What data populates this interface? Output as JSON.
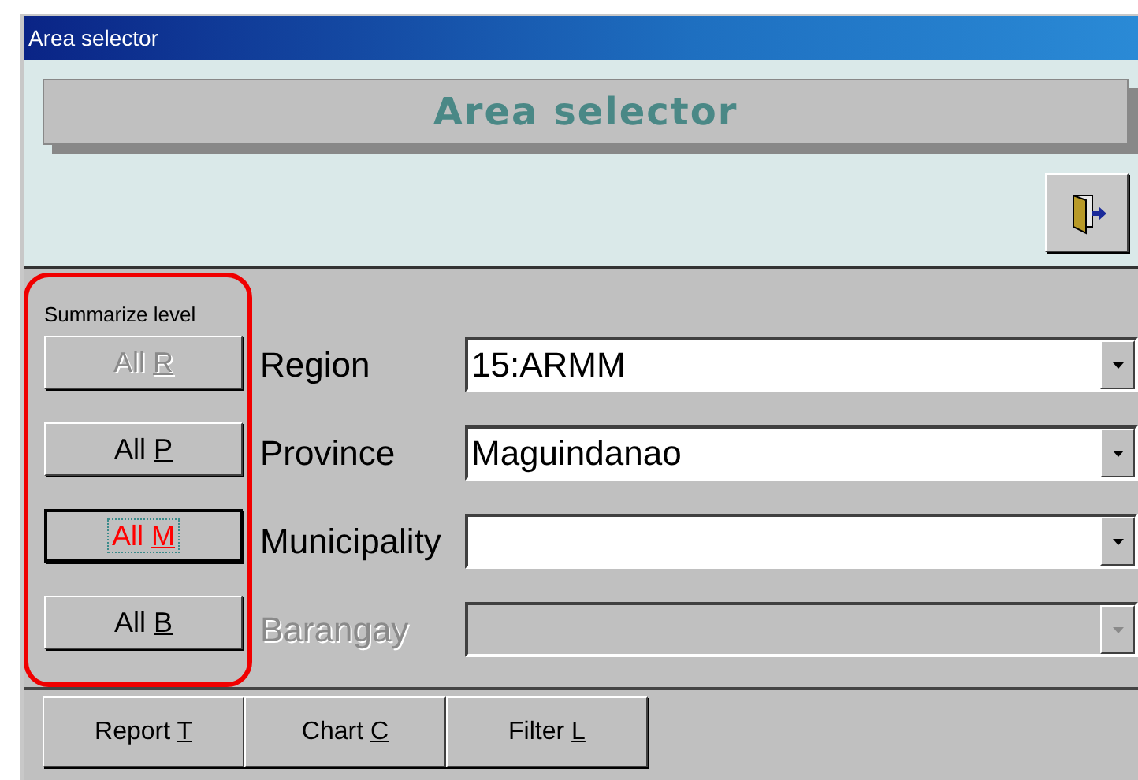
{
  "window": {
    "title": "Area selector"
  },
  "banner": {
    "title": "Area selector"
  },
  "summarize": {
    "label": "Summarize level",
    "highlighted": true,
    "buttons": [
      {
        "label": "All",
        "key": "R",
        "disabled": true,
        "focused": false
      },
      {
        "label": "All",
        "key": "P",
        "disabled": false,
        "focused": false
      },
      {
        "label": "All",
        "key": "M",
        "disabled": false,
        "focused": true
      },
      {
        "label": "All",
        "key": "B",
        "disabled": false,
        "focused": false
      }
    ]
  },
  "fields": [
    {
      "label": "Region",
      "value": "15:ARMM",
      "disabled": false
    },
    {
      "label": "Province",
      "value": "Maguindanao",
      "disabled": false
    },
    {
      "label": "Municipality",
      "disabled": false
    },
    {
      "label": "Barangay",
      "disabled": true
    }
  ],
  "footer_buttons": [
    {
      "label": "Report",
      "key": "T"
    },
    {
      "label": "Chart",
      "key": "C"
    },
    {
      "label": "Filter",
      "key": "L"
    }
  ]
}
